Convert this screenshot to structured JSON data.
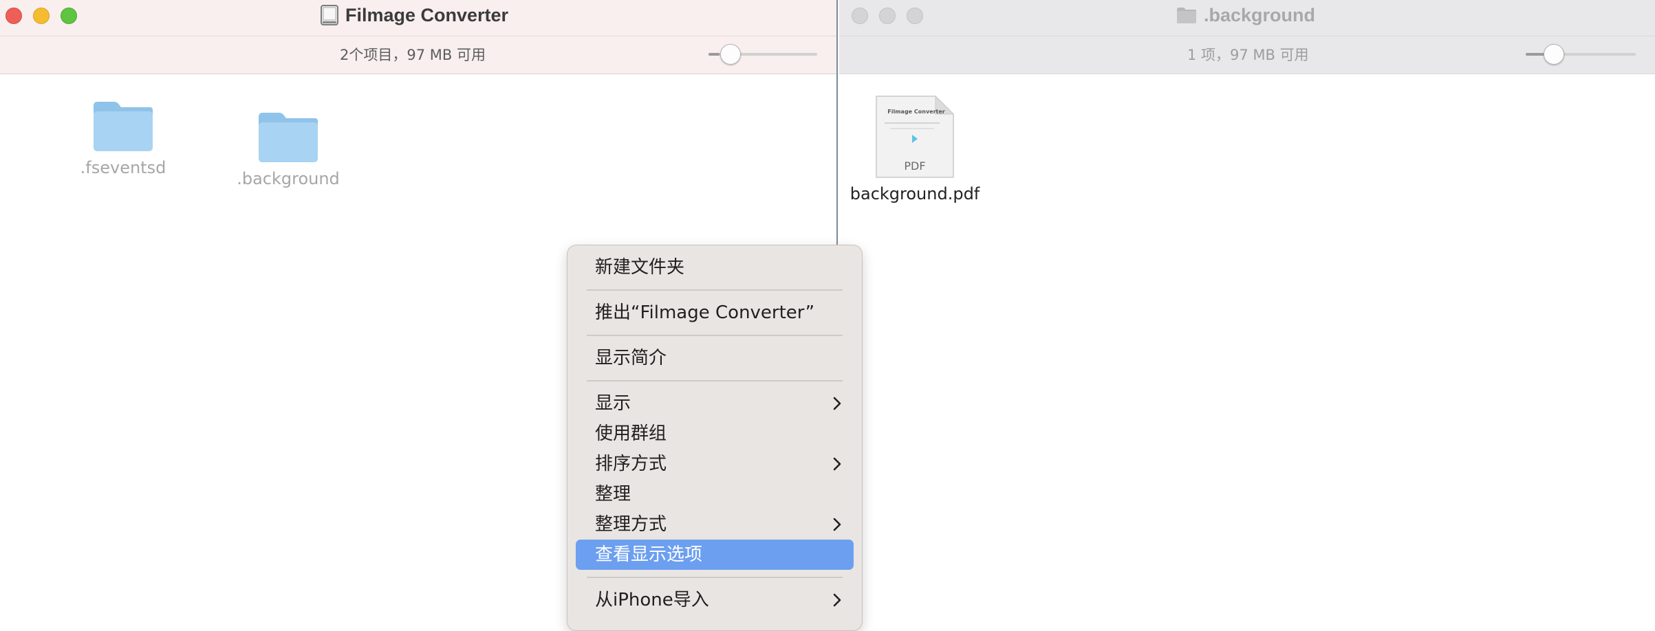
{
  "left_window": {
    "title": "Filmage Converter",
    "title_icon": "disk-icon",
    "status": "2个项目，97 MB 可用",
    "zoom_level": 0.1,
    "items": [
      {
        "label": ".fseventsd",
        "icon": "folder-icon"
      },
      {
        "label": ".background",
        "icon": "folder-icon"
      }
    ]
  },
  "right_window": {
    "title": ".background",
    "title_icon": "folder-icon",
    "status": "1 项，97 MB 可用",
    "zoom_level": 0.26,
    "items": [
      {
        "label": "background.pdf",
        "icon": "pdf-file-icon",
        "thumb_title": "Filmage Converter",
        "thumb_badge": "PDF"
      }
    ]
  },
  "context_menu": {
    "items": [
      {
        "label": "新建文件夹"
      },
      {
        "label": "推出“Filmage Converter”"
      },
      {
        "label": "显示简介"
      },
      {
        "label": "显示",
        "submenu": true
      },
      {
        "label": "使用群组"
      },
      {
        "label": "排序方式",
        "submenu": true
      },
      {
        "label": "整理"
      },
      {
        "label": "整理方式",
        "submenu": true
      },
      {
        "label": "查看显示选项",
        "highlighted": true
      },
      {
        "label": "从iPhone导入",
        "submenu": true
      }
    ]
  },
  "colors": {
    "menu_highlight": "#6c9ff0",
    "close": "#ee5f57",
    "minimize": "#f5bc2f",
    "maximize": "#5fc440",
    "folder": "#a9d3f2"
  }
}
